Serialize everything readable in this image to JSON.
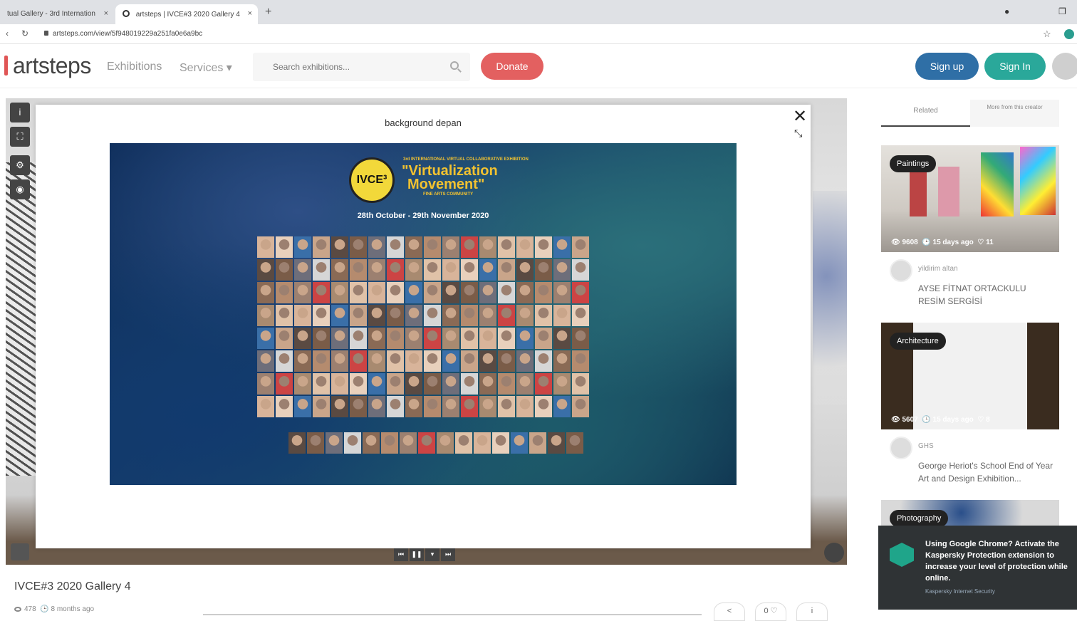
{
  "browser": {
    "tabs": [
      {
        "label": "tual Gallery - 3rd Internation"
      },
      {
        "label": "artsteps | IVCE#3 2020 Gallery 4"
      }
    ],
    "url": "artsteps.com/view/5f948019229a251fa0e6a9bc",
    "new_tab": "+"
  },
  "site": {
    "logo": "artsteps",
    "nav": [
      "Exhibitions",
      "Services ▾"
    ],
    "search_placeholder": "Search exhibitions...",
    "donate": "Donate",
    "signup": "Sign up",
    "signin": "Sign In"
  },
  "modal": {
    "title": "background depan",
    "close": "✕",
    "artwork": {
      "emblem": "IVCE³",
      "small_top": "3rd INTERNATIONAL VIRTUAL COLLABORATIVE EXHIBITION",
      "line1": "\"Virtualization",
      "line2": "Movement\"",
      "small_bottom": "FINE ARTS COMMUNITY",
      "dates": "28th October - 29th November 2020"
    }
  },
  "exhibition": {
    "title": "IVCE#3 2020 Gallery 4",
    "views": "478",
    "age": "8 months ago"
  },
  "right_panel": {
    "tabs": [
      "Related",
      "More from this creator"
    ],
    "cards": [
      {
        "badge": "Paintings",
        "views": "9608",
        "age": "15 days ago",
        "likes": "11",
        "user": "yildirim altan",
        "name": "AYSE FİTNAT ORTACKULU RESİM SERGİSİ"
      },
      {
        "badge": "Architecture",
        "views": "5607",
        "age": "15 days ago",
        "likes": "8",
        "user": "GHS",
        "name": "George Heriot's School End of Year Art and Design Exhibition..."
      },
      {
        "badge": "Photography",
        "views": "",
        "age": "",
        "likes": "",
        "user": "",
        "name": ""
      }
    ]
  },
  "toast": {
    "text": "Using Google Chrome? Activate the Kaspersky Protection extension to increase your level of protection while online.",
    "source": "Kaspersky Internet Security"
  },
  "colors": {
    "donate": "#e36060",
    "signup": "#2f6fa6",
    "signin": "#2aa89a",
    "kaspersky": "#1fa58a"
  }
}
